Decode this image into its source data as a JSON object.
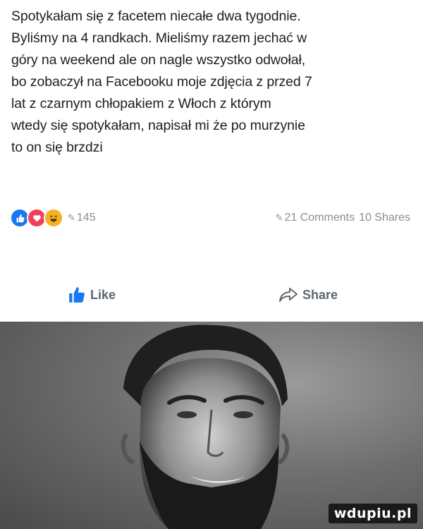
{
  "post": {
    "text": "Spotykałam się z facetem niecałe dwa tygodnie.\nByliśmy na 4 randkach. Mieliśmy razem jechać w\ngóry na weekend ale on nagle wszystko odwołał,\nbo zobaczył na Facebooku moje zdjęcia z przed 7\nlat z czarnym chłopakiem z Włoch z którym\nwtedy się spotykałam, napisał mi że po murzynie\nto on się brzdzi"
  },
  "reactions": {
    "icons": [
      "like-icon",
      "love-icon",
      "haha-icon"
    ],
    "count": "145"
  },
  "stats": {
    "comments": "21 Comments",
    "shares": "10 Shares"
  },
  "actions": {
    "like_label": "Like",
    "share_label": "Share"
  },
  "image": {
    "watermark": "wdupiu.pl"
  },
  "colors": {
    "like_blue": "#1877f2",
    "love_red": "#f33e58",
    "haha_yellow": "#f7b125",
    "text": "#1c1e21",
    "muted": "#8a8d91"
  }
}
